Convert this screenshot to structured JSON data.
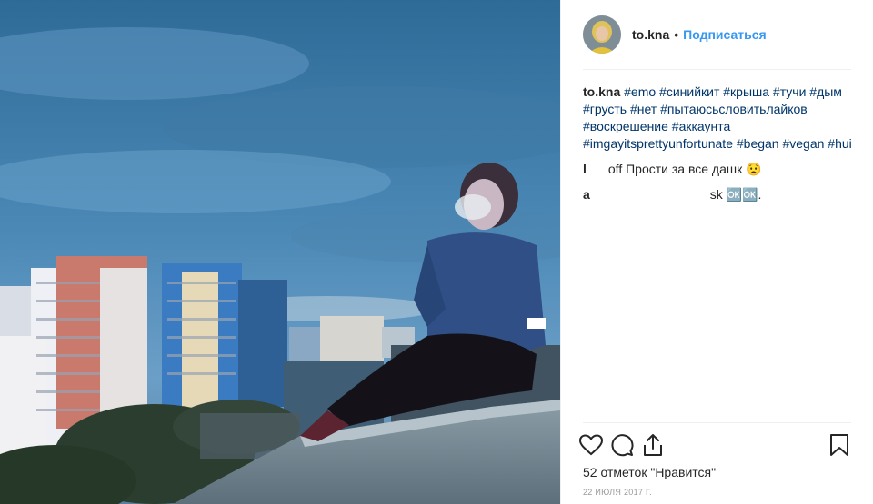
{
  "post": {
    "author": "to.kna",
    "follow_label": "Подписаться",
    "separator": "•",
    "caption": {
      "author": "to.kna",
      "text": "#emo #синийкит #крыша #тучи #дым #грусть #нет #пытаюсьсловитьлайков #воскрешение #аккаунта #imgayitsprettyunfortunate #began #vegan #hui"
    },
    "comments": [
      {
        "author": "l",
        "text": "off Прости за все дашк 😟"
      },
      {
        "author": "a",
        "text": "sk 🆗🆗."
      }
    ],
    "likes_label": "52 отметок \"Нравится\"",
    "date": "22 июля 2017 г."
  },
  "icons": {
    "like": "heart-icon",
    "comment": "comment-bubble-icon",
    "share": "share-icon",
    "save": "bookmark-icon"
  },
  "colors": {
    "follow": "#3897f0",
    "hashtag": "#003569",
    "muted": "#999999"
  }
}
